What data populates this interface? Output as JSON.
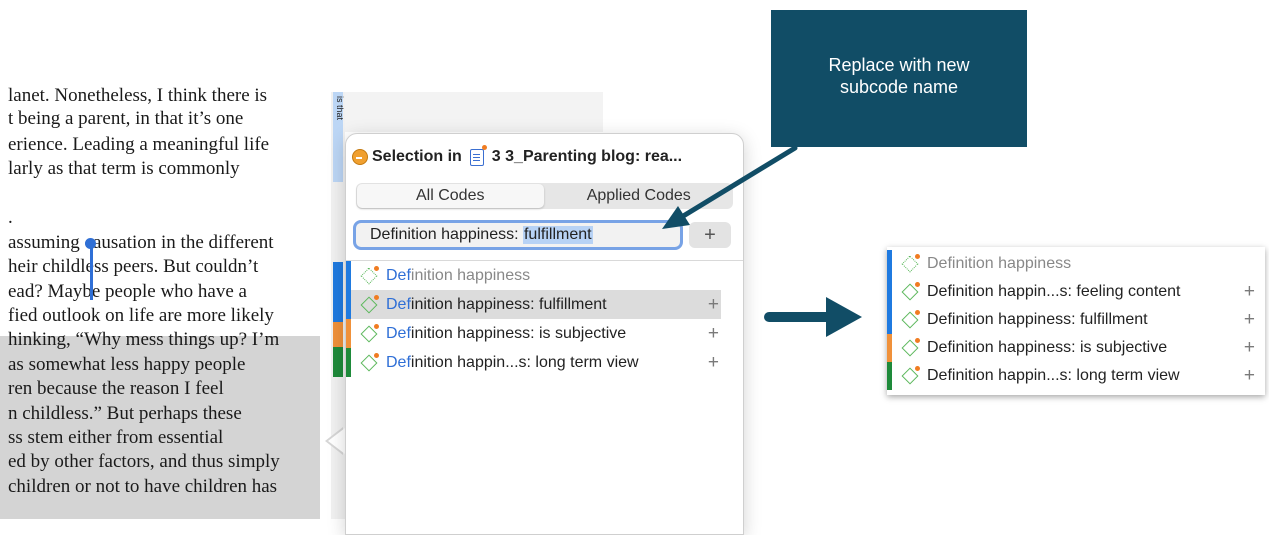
{
  "document": {
    "lines": [
      "lanet. Nonetheless, I think there is",
      "t being a parent, in that it’s one",
      "erience. Leading a meaningful life",
      "larly as that term is commonly",
      ".",
      "assuming causation in the different",
      "heir childless peers. But couldn’t",
      "ead? Maybe people who have a",
      "fied outlook on life are more likely",
      "hinking, “Why mess things up? I’m",
      "as somewhat less happy people",
      "ren because the reason I feel",
      "n childless.” But perhaps these",
      "ss stem either from essential",
      "ed by other factors, and thus simply",
      " children or not to have children has"
    ],
    "stripe_label": "is that"
  },
  "popover": {
    "title_prefix": "Selection in",
    "document_name": "3 3_Parenting blog: rea...",
    "tabs": [
      "All Codes",
      "Applied Codes"
    ],
    "field_prefix": "Definition happiness: ",
    "field_highlight": "fulfillment",
    "add_label": "+",
    "codes": [
      {
        "match": "Def",
        "rest": "inition happiness",
        "plus": ""
      },
      {
        "match": "Def",
        "rest": "inition happiness: fulfillment",
        "plus": "+"
      },
      {
        "match": "Def",
        "rest": "inition happiness: is subjective",
        "plus": "+"
      },
      {
        "match": "Def",
        "rest": "inition happin...s: long term view",
        "plus": "+"
      }
    ]
  },
  "callout": {
    "line1": "Replace with new",
    "line2": "subcode name"
  },
  "result_list": [
    {
      "label": "Definition happiness",
      "plus": ""
    },
    {
      "label": "Definition happin...s: feeling content",
      "plus": "+"
    },
    {
      "label": "Definition happiness: fulfillment",
      "plus": "+"
    },
    {
      "label": "Definition happiness: is subjective",
      "plus": "+"
    },
    {
      "label": "Definition happin...s: long term view",
      "plus": "+"
    }
  ],
  "colors": {
    "accent": "#2f6fd6",
    "callout_bg": "#114d66",
    "stripe_blue": "#1f7ae0",
    "stripe_orange": "#f0913a",
    "stripe_green": "#1e8a3a",
    "code_green": "#5cb85c"
  },
  "icons": [
    "status-icon",
    "document-icon",
    "code-icon",
    "plus-icon",
    "arrow-icon"
  ]
}
